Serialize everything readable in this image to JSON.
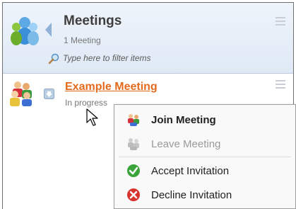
{
  "header": {
    "title": "Meetings",
    "count": "1 Meeting",
    "filter_placeholder": "Type here to filter items",
    "app_icon": "people-group-icon",
    "back_icon": "back-arrow-icon",
    "filter_icon": "magnifier-icon",
    "menu_icon": "menu-lines-icon"
  },
  "meeting": {
    "title": "Example Meeting",
    "status": "In progress",
    "icon": "group-meeting-icon",
    "action_icon": "download-arrow-icon",
    "menu_icon": "menu-lines-icon"
  },
  "context_menu": {
    "items": [
      {
        "label": "Join Meeting",
        "icon": "join-meeting-icon",
        "bold": true,
        "enabled": true
      },
      {
        "label": "Leave Meeting",
        "icon": "leave-meeting-icon",
        "bold": false,
        "enabled": false
      },
      {
        "label": "Accept Invitation",
        "icon": "accept-check-icon",
        "bold": false,
        "enabled": true
      },
      {
        "label": "Decline Invitation",
        "icon": "decline-x-icon",
        "bold": false,
        "enabled": true
      }
    ]
  },
  "colors": {
    "link": "#e56a1b",
    "header_bg": "#e6eef8",
    "accept": "#3aa43a",
    "decline": "#d9312b"
  }
}
